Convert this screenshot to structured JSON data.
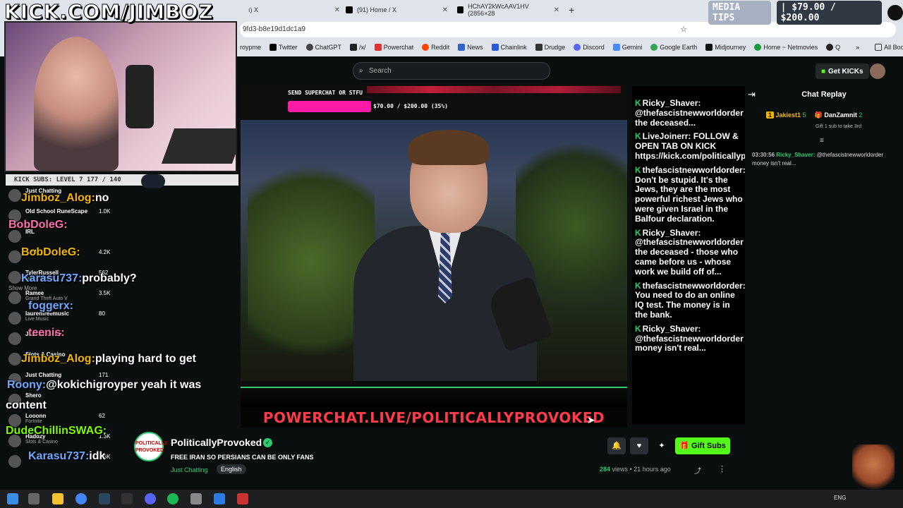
{
  "browser": {
    "tabs": [
      {
        "label": "ı) X"
      },
      {
        "label": "(91) Home / X"
      },
      {
        "label": "HChAY2kWcAAV1HV (2856×28"
      }
    ],
    "address": "9fd3-b8e19d1dc1a9",
    "bookmarks": [
      "roypme",
      "Twitter",
      "ChatGPT",
      "/x/",
      "Powerchat",
      "Reddit",
      "News",
      "Chainlink",
      "Drudge",
      "Discord",
      "Gemini",
      "Google Earth",
      "Midjourney",
      "Home ~ Netmovies",
      "Q",
      "All Bookmarks"
    ]
  },
  "overlay": {
    "brand": "KICK.COM/JIMBOZ",
    "subs_label": "KICK SUBS: LEVEL 7 177 / 140",
    "media_tips_label": "MEDIA TIPS",
    "media_tips_amount": "| $79.00 / $200.00",
    "supercat_label": "SEND SUPERCHAT OR STFU",
    "supercat_amount": "$70.00 / $200.00 (35%)",
    "supercat_progress": 0.35,
    "powerchat_banner": "POWERCHAT.LIVE/POLITICALLYPROVOKED"
  },
  "kick": {
    "search_placeholder": "Search",
    "get_kicks": "Get KICKs",
    "chat_title": "Chat Replay",
    "leaderboard": [
      {
        "rank": "1",
        "name": "Jakiest1",
        "count": "5"
      },
      {
        "name": "DanZamnit",
        "count": "2"
      }
    ],
    "leaderboard_sub": "Gift 1 sub to take 3rd",
    "chat_message": {
      "time": "03:30:56",
      "user": "Ricky_Shaver:",
      "text": "@thefascistnewworldorder money isn't real..."
    },
    "channel_name": "PoliticallyProvoked",
    "stream_title": "FREE IRAN SO PERSIANS CAN BE ONLY FANS",
    "category": "Just Chatting",
    "language": "English",
    "gift_subs": "Gift Subs",
    "views": "284",
    "views_label": "views",
    "age": "• 21 hours ago",
    "avatar_text": "POLITICALLY PROVOKED"
  },
  "overlay_chat": [
    {
      "name": "Ricky_Shaver:",
      "text": "@thefascistnewworldorder the deceased..."
    },
    {
      "name": "LiveJoinerr:",
      "text": "FOLLOW & OPEN TAB ON KICK https://kick.com/politicallyprovoked"
    },
    {
      "name": "thefascistnewworldorder:",
      "text": "Don't be stupid. It's the Jews, they are the most powerful richest Jews who were given Israel in the Balfour declaration."
    },
    {
      "name": "Ricky_Shaver:",
      "text": "@thefascistnewworldorder the deceased - those who came before us - whose work we build off of..."
    },
    {
      "name": "thefascistnewworldorder:",
      "text": "You need to do an online IQ test. The money is in the bank."
    },
    {
      "name": "Ricky_Shaver:",
      "text": "@thefascistnewworldorder money isn't real..."
    }
  ],
  "left_nav": [
    {
      "name": "Just Chatting",
      "cat": "",
      "count": ""
    },
    {
      "name": "Old School RuneScape",
      "cat": "",
      "count": "1.0K"
    },
    {
      "name": "IRL",
      "cat": "",
      "count": ""
    },
    {
      "name": "Buddha",
      "cat": "",
      "count": "4.2K"
    },
    {
      "name": "TylerRussell",
      "cat": "Just Chatting",
      "count": "562"
    },
    {
      "name": "Ramee",
      "cat": "Grand Theft Auto V",
      "count": "3.5K"
    },
    {
      "name": "laurenfreemusic",
      "cat": "Live Music",
      "count": "80"
    },
    {
      "name": "Just Chatting",
      "cat": "",
      "count": ""
    },
    {
      "name": "Slots & Casino",
      "cat": "",
      "count": ""
    },
    {
      "name": "Just Chatting",
      "cat": "",
      "count": "171"
    },
    {
      "name": "Shero",
      "cat": "",
      "count": ""
    },
    {
      "name": "Looonn",
      "cat": "Fortnite",
      "count": "62"
    },
    {
      "name": "Haddzy",
      "cat": "Slots & Casino",
      "count": "1.3K"
    },
    {
      "name": "",
      "cat": "",
      "count": "9.3K"
    }
  ],
  "show_more": "Show More",
  "big_chat": [
    {
      "name": "Jimboz_Alog:",
      "text": "no"
    },
    {
      "name": "BobDoleG:",
      "text": ""
    },
    {
      "name": "BobDoleG:",
      "text": ""
    },
    {
      "name": "Karasu737:",
      "text": "probably?"
    },
    {
      "name": "foggerx:",
      "text": ""
    },
    {
      "name": "teenis:",
      "text": ""
    },
    {
      "name": "Jimboz_Alog:",
      "text": "playing hard to get"
    },
    {
      "name": "Roony:",
      "text": "@kokichigroyper yeah it was"
    },
    {
      "name": "",
      "text": "content"
    },
    {
      "name": "DudeChillinSWAG:",
      "text": ""
    },
    {
      "name": "Karasu737:",
      "text": "idk"
    }
  ],
  "taskbar": {
    "lang": "ENG"
  }
}
